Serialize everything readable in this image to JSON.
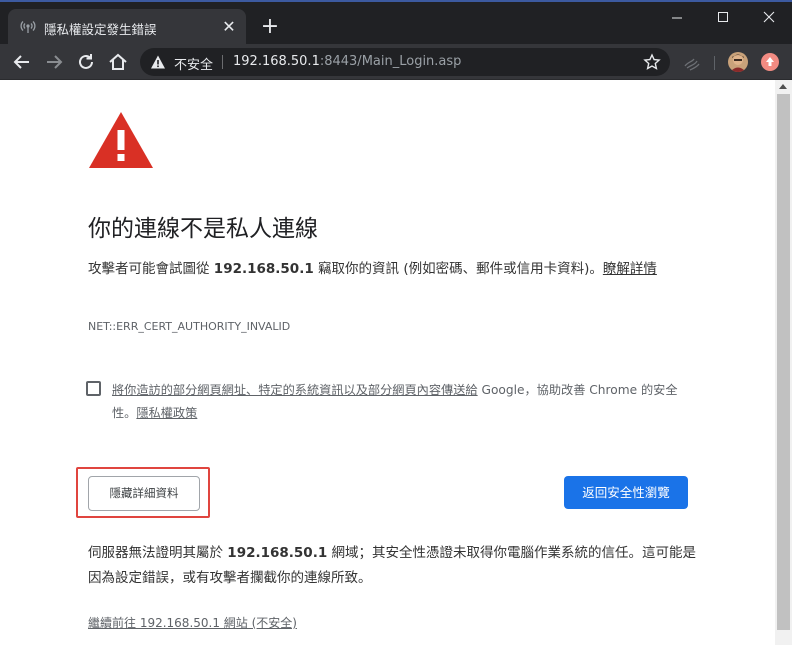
{
  "tab": {
    "title": "隱私權設定發生錯誤",
    "favicon_icon": "broadcast-icon",
    "close_icon": "close-icon"
  },
  "window": {
    "new_tab_label": "+",
    "minimize_icon": "minimize-icon",
    "maximize_icon": "maximize-icon",
    "close_icon": "close-icon"
  },
  "toolbar": {
    "security_label": "不安全",
    "url_host": "192.168.50.1",
    "url_rest": ":8443/Main_Login.asp"
  },
  "page": {
    "heading": "你的連線不是私人連線",
    "desc_before": "攻擊者可能會試圖從 ",
    "desc_host": "192.168.50.1",
    "desc_after": " 竊取你的資訊 (例如密碼、郵件或信用卡資料)。",
    "learn_more": "瞭解詳情",
    "error_code": "NET::ERR_CERT_AUTHORITY_INVALID",
    "optin_link": "將你造訪的部分網頁網址、特定的系統資訊以及部分網頁內容傳送給",
    "optin_rest": " Google，協助改善 Chrome 的安全性。",
    "privacy_link": "隱私權政策",
    "hide_details_button": "隱藏詳細資料",
    "back_button": "返回安全性瀏覽",
    "explain_before": "伺服器無法證明其屬於 ",
    "explain_host": "192.168.50.1",
    "explain_after": " 網域；其安全性憑證未取得你電腦作業系統的信任。這可能是因為設定錯誤，或有攻擊者攔截你的連線所致。",
    "proceed_link": "繼續前往 192.168.50.1 網站 (不安全)"
  },
  "colors": {
    "accent": "#1a73e8",
    "warning": "#d93025",
    "highlight": "#e0453f"
  }
}
